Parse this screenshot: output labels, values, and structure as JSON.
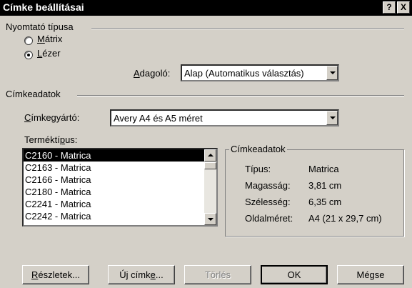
{
  "window": {
    "title": "Címke beállításai",
    "help_label": "?",
    "close_label": "X"
  },
  "printer_type": {
    "group_label": "Nyomtató típusa",
    "matrix_label": "Mátrix",
    "laser_label": "Lézer",
    "selected": "laser",
    "feeder_label": "Adagoló:",
    "feeder_value": "Alap (Automatikus választás)"
  },
  "label_info": {
    "group_label": "Címkeadatok",
    "vendor_label": "Címkegyártó:",
    "vendor_value": "Avery A4 és A5 méret",
    "product_type_label": "Terméktípus:",
    "product_items": [
      "C2160 - Matrica",
      "C2163 - Matrica",
      "C2166 - Matrica",
      "C2180 - Matrica",
      "C2241 - Matrica",
      "C2242 - Matrica"
    ],
    "selected_index": 0
  },
  "details": {
    "group_label": "Címkeadatok",
    "type_label": "Típus:",
    "type_value": "Matrica",
    "height_label": "Magasság:",
    "height_value": "3,81 cm",
    "width_label": "Szélesség:",
    "width_value": "6,35 cm",
    "page_size_label": "Oldalméret:",
    "page_size_value": "A4 (21 x 29,7 cm)"
  },
  "buttons": {
    "details_label": "Részletek...",
    "new_label": "Új címke...",
    "delete_label": "Törlés",
    "ok_label": "OK",
    "cancel_label": "Mégse"
  }
}
